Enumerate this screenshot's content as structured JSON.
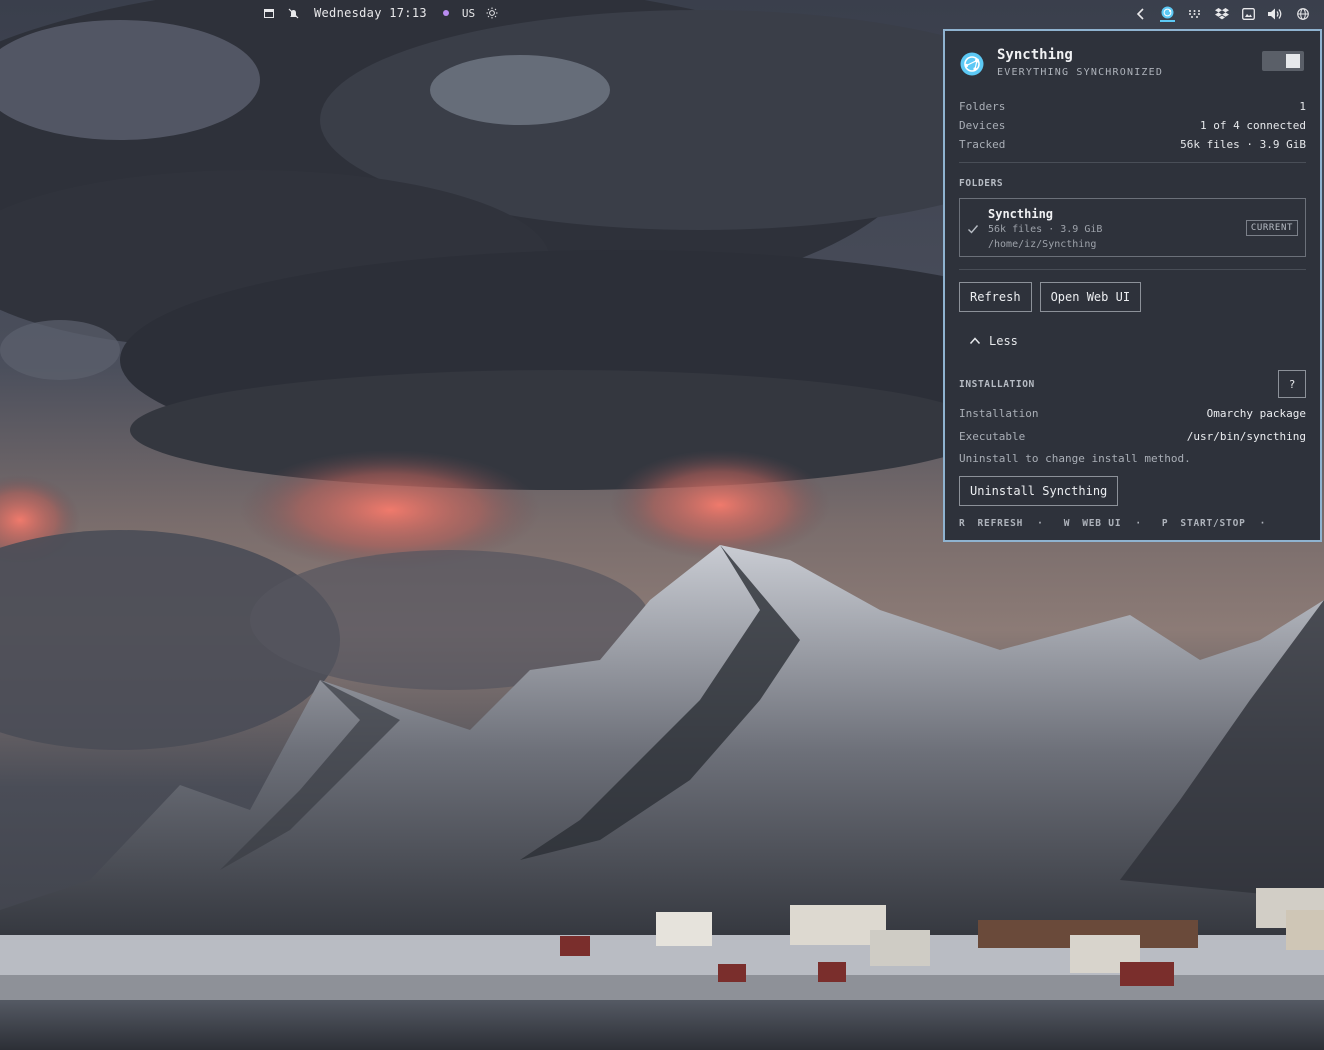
{
  "topbar": {
    "clock": "Wednesday 17:13",
    "keyboard_layout": "US",
    "accent_dot_color": "#b98cf0",
    "icons_left": [
      "terminal-icon",
      "notifications-off-icon"
    ],
    "icons_right": [
      "chevron-left-icon",
      "syncthing-tray-icon",
      "dots-grid-icon",
      "dropbox-icon",
      "screen-share-icon",
      "volume-icon",
      "globe-icon"
    ]
  },
  "popup": {
    "title": "Syncthing",
    "status": "EVERYTHING SYNCHRONIZED",
    "stats": [
      {
        "label": "Folders",
        "value": "1"
      },
      {
        "label": "Devices",
        "value": "1 of 4 connected"
      },
      {
        "label": "Tracked",
        "value": "56k files · 3.9 GiB"
      }
    ],
    "folders_heading": "FOLDERS",
    "folder": {
      "name": "Syncthing",
      "meta": "56k files · 3.9 GiB",
      "path": "/home/iz/Syncthing",
      "badge": "CURRENT"
    },
    "buttons": {
      "refresh": "Refresh",
      "open_web_ui": "Open Web UI",
      "less": "Less",
      "help": "?",
      "uninstall": "Uninstall Syncthing"
    },
    "installation_heading": "INSTALLATION",
    "installation": [
      {
        "label": "Installation",
        "value": "Omarchy package"
      },
      {
        "label": "Executable",
        "value": "/usr/bin/syncthing"
      }
    ],
    "note": "Uninstall to change install method.",
    "shortcuts": [
      {
        "key": "R",
        "label": "REFRESH"
      },
      {
        "key": "W",
        "label": "WEB UI"
      },
      {
        "key": "P",
        "label": "START/STOP"
      }
    ],
    "accent_color": "#5cc9f5",
    "border_color": "#8fb3d0"
  }
}
